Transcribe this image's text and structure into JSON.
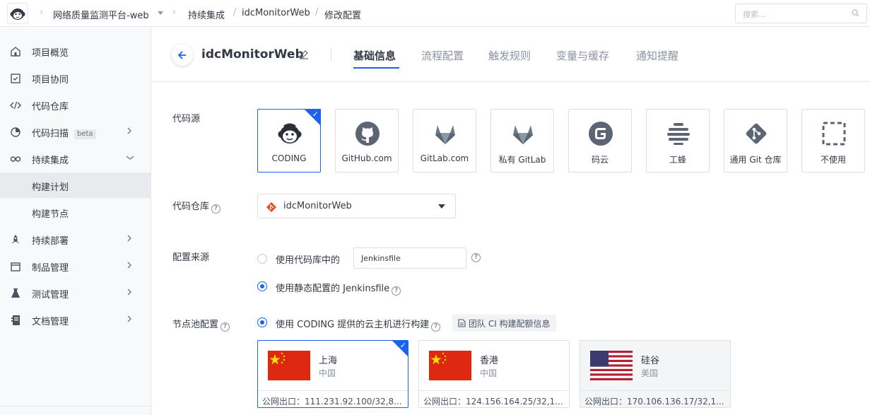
{
  "topbar": {
    "project": "网络质量监测平台-web",
    "crumbs": [
      "持续集成",
      "idcMonitorWeb",
      "修改配置"
    ],
    "search_placeholder": "搜索..."
  },
  "sidebar": {
    "items": [
      {
        "label": "项目概览",
        "icon": "home-icon"
      },
      {
        "label": "项目协同",
        "icon": "check-square-icon"
      },
      {
        "label": "代码仓库",
        "icon": "code-icon"
      },
      {
        "label": "代码扫描",
        "icon": "scan-icon",
        "badge": "beta"
      },
      {
        "label": "持续集成",
        "icon": "infinity-icon"
      },
      {
        "label": "构建计划",
        "sub": true,
        "active": true
      },
      {
        "label": "构建节点",
        "sub": true
      },
      {
        "label": "持续部署",
        "icon": "rocket-icon"
      },
      {
        "label": "制品管理",
        "icon": "box-icon"
      },
      {
        "label": "测试管理",
        "icon": "flask-icon"
      },
      {
        "label": "文档管理",
        "icon": "doc-icon"
      }
    ]
  },
  "header": {
    "title": "idcMonitorWeb",
    "tabs": [
      "基础信息",
      "流程配置",
      "触发规则",
      "变量与缓存",
      "通知提醒"
    ]
  },
  "form": {
    "source_label": "代码源",
    "sources": [
      {
        "label": "CODING",
        "icon": "coding-icon",
        "selected": true
      },
      {
        "label": "GitHub.com",
        "icon": "github-icon"
      },
      {
        "label": "GitLab.com",
        "icon": "gitlab-icon"
      },
      {
        "label": "私有 GitLab",
        "icon": "gitlab-private-icon"
      },
      {
        "label": "码云",
        "icon": "gitee-icon"
      },
      {
        "label": "工蜂",
        "icon": "gongfeng-icon"
      },
      {
        "label": "通用 Git 仓库",
        "icon": "git-icon"
      },
      {
        "label": "不使用",
        "icon": "none-icon"
      }
    ],
    "repo_label": "代码仓库",
    "repo_value": "idcMonitorWeb",
    "config_label": "配置来源",
    "config_option1": "使用代码库中的",
    "config_option1_value": "Jenkinsfile",
    "config_option2": "使用静态配置的 Jenkinsfile",
    "node_label": "节点池配置",
    "node_option": "使用 CODING 提供的云主机进行构建",
    "quota_button": "团队 CI 构建配额信息",
    "regions": [
      {
        "name": "上海",
        "country": "中国",
        "ip": "公网出口：111.231.92.100/32,8...",
        "flag": "cn",
        "selected": true
      },
      {
        "name": "香港",
        "country": "中国",
        "ip": "公网出口：124.156.164.25/32,1...",
        "flag": "cn"
      },
      {
        "name": "硅谷",
        "country": "美国",
        "ip": "公网出口：170.106.136.17/32,1...",
        "flag": "us",
        "disabled": true
      }
    ]
  },
  "colors": {
    "accent": "#1b62ec",
    "text": "#323a45",
    "muted": "#8b93a1"
  }
}
